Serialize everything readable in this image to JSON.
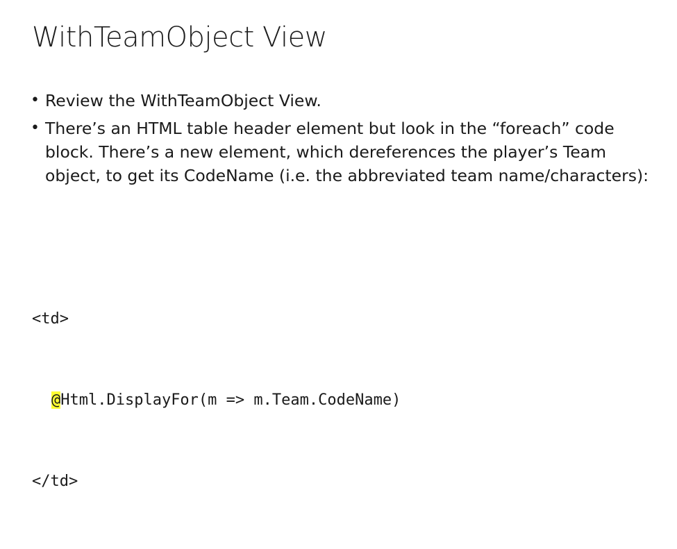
{
  "slide": {
    "title": "WithTeamObject View",
    "bullets": [
      "Review the WithTeamObject View.",
      "There’s an HTML table header element but look in the “foreach” code block.  There’s a new element, which dereferences the player’s Team object, to get its CodeName (i.e. the abbreviated team name/characters):"
    ],
    "bullet_glyph": "•",
    "code": {
      "line1": "<td>",
      "line2_highlight": "@",
      "line2_rest": "Html.DisplayFor(m => m.Team.CodeName)",
      "line3": "</td>"
    },
    "highlight_color": "#ffff33"
  }
}
